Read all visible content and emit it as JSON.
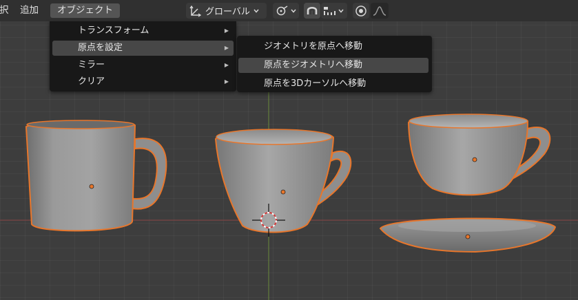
{
  "header": {
    "menu": [
      {
        "label": "択",
        "active": false
      },
      {
        "label": "追加",
        "active": false
      },
      {
        "label": "オブジェクト",
        "active": true
      }
    ],
    "transform_orientation": "グローバル"
  },
  "object_menu": {
    "items": [
      {
        "label": "トランスフォーム",
        "has_submenu": true,
        "highlighted": false
      },
      {
        "label": "原点を設定",
        "has_submenu": true,
        "highlighted": true
      },
      {
        "label": "ミラー",
        "has_submenu": true,
        "highlighted": false
      },
      {
        "label": "クリア",
        "has_submenu": true,
        "highlighted": false
      }
    ]
  },
  "set_origin_submenu": {
    "items": [
      {
        "label": "ジオメトリを原点へ移動",
        "highlighted": false
      },
      {
        "label": "原点をジオメトリへ移動",
        "highlighted": true
      },
      {
        "label": "原点を3Dカーソルへ移動",
        "highlighted": false
      }
    ]
  },
  "scene": {
    "objects": [
      "mug",
      "teacup",
      "wide-cup",
      "saucer"
    ],
    "colors": {
      "background": "#3d3d3d",
      "selection_outline": "#e8762b",
      "origin_dot": "#e8762b",
      "mesh": "#8c8c8c"
    }
  }
}
